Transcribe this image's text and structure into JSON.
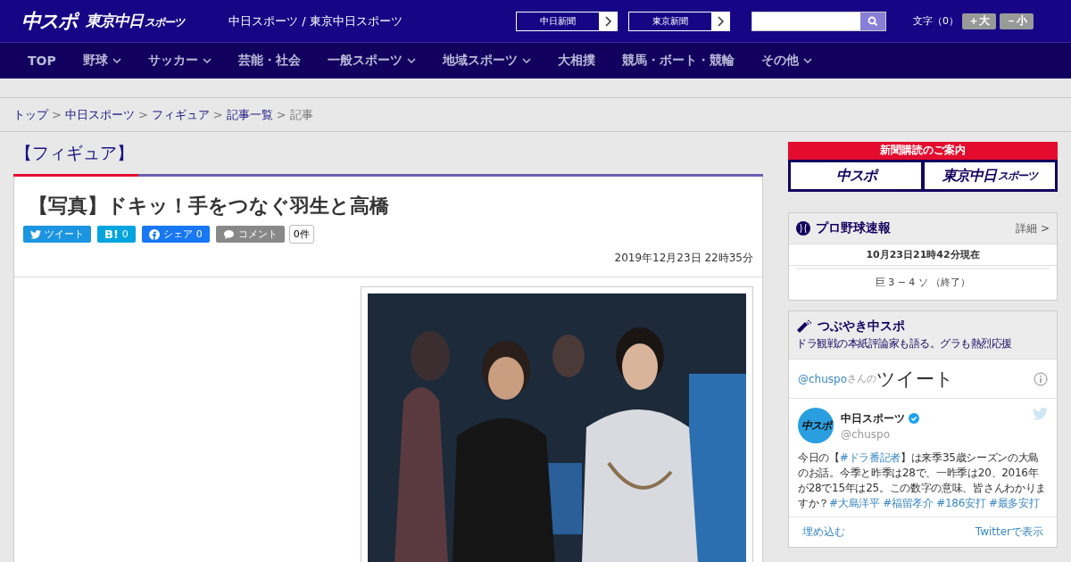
{
  "header": {
    "logo_main": "中スポ",
    "logo_sub": "東京中日",
    "logo_sub_small": "スポーツ",
    "site_title": "中日スポーツ / 東京中日スポーツ",
    "links": [
      "中日新聞",
      "東京新聞"
    ],
    "font_size_label": "文字（0）",
    "font_buttons": [
      "＋大",
      "－小"
    ]
  },
  "nav": [
    {
      "label": "TOP",
      "dropdown": false
    },
    {
      "label": "野球",
      "dropdown": true
    },
    {
      "label": "サッカー",
      "dropdown": true
    },
    {
      "label": "芸能・社会",
      "dropdown": false
    },
    {
      "label": "一般スポーツ",
      "dropdown": true
    },
    {
      "label": "地域スポーツ",
      "dropdown": true
    },
    {
      "label": "大相撲",
      "dropdown": false
    },
    {
      "label": "競馬・ボート・競輪",
      "dropdown": false
    },
    {
      "label": "その他",
      "dropdown": true
    }
  ],
  "breadcrumb": [
    {
      "label": "トップ",
      "link": true
    },
    {
      "separator": ">",
      "label": "中日スポーツ",
      "link": true
    },
    {
      "separator": ">",
      "label": "フィギュア",
      "link": true
    },
    {
      "separator": ">",
      "label": "記事一覧",
      "link": true
    },
    {
      "separator": ">",
      "label": "記事",
      "link": false
    }
  ],
  "category": "【フィギュア】",
  "article": {
    "title": "【写真】ドキッ！手をつなぐ羽生と高橋",
    "share": [
      {
        "kind": "twitter",
        "label": "ツイート"
      },
      {
        "kind": "hatena",
        "label": "B!",
        "count": "0"
      },
      {
        "kind": "facebook",
        "label": "シェア",
        "count": "0"
      },
      {
        "kind": "comment",
        "label": "コメント"
      }
    ],
    "comment_count": "0件",
    "date": "2019年12月23日 22時35分"
  },
  "subscribe": {
    "title": "新聞購読のご案内",
    "logos": [
      "中スポ",
      "東京中日"
    ],
    "logo_small": "スポーツ"
  },
  "baseball": {
    "title": "プロ野球速報",
    "more": "詳細 >",
    "updated": "10月23日21時42分現在",
    "games": [
      "巨 3 − 4 ソ （終了）"
    ]
  },
  "tweets": {
    "title": "つぶやき中スポ",
    "subtitle": "ドラ観戦の本紙評論家も語る。グラも熱烈応援",
    "handle": "@chuspo",
    "handle_suffix": "さんの",
    "heading": "ツイート",
    "account_name": "中日スポーツ",
    "account_handle": "@chuspo",
    "avatar": "中スポ",
    "text": [
      {
        "kind": "plain",
        "text": "今日の【"
      },
      {
        "kind": "tag",
        "text": "#ドラ番記者"
      },
      {
        "kind": "plain",
        "text": "】は来季35歳シーズンの大島のお話。今季と昨季は28で、一昨季は20、2016年が28で15年は25。この数字の意味、皆さんわかりますか？"
      },
      {
        "kind": "tag",
        "text": "#大島洋平"
      },
      {
        "kind": "tag",
        "text": "#福留孝介"
      },
      {
        "kind": "tag",
        "text": "#186安打"
      },
      {
        "kind": "tag",
        "text": "#最多安打"
      }
    ],
    "embed": "埋め込む",
    "view": "Twitterで表示"
  }
}
